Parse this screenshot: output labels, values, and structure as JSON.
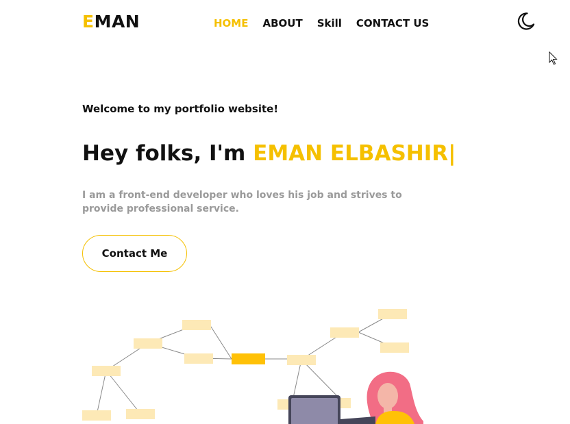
{
  "header": {
    "logo_first": "E",
    "logo_rest": "MAN",
    "nav": [
      {
        "label": "HOME",
        "active": true
      },
      {
        "label": "ABOUT",
        "active": false
      },
      {
        "label": "Skill",
        "active": false
      },
      {
        "label": "CONTACT US",
        "active": false
      }
    ],
    "theme_toggle_icon": "moon-icon"
  },
  "hero": {
    "welcome": "Welcome to my portfolio website!",
    "greeting": "Hey folks, I'm ",
    "name": "EMAN ELBASHIR|",
    "description": "I am a front-end developer who loves his job and strives to provide professional service.",
    "cta_label": "Contact Me"
  },
  "colors": {
    "accent": "#f5c000",
    "text": "#111111",
    "muted": "#9a9a9a",
    "node_light": "#fde9b6",
    "node_dark": "#ffc107",
    "laptop": "#8e8aa8",
    "hair": "#f26d85",
    "skin": "#f4b6a8"
  }
}
